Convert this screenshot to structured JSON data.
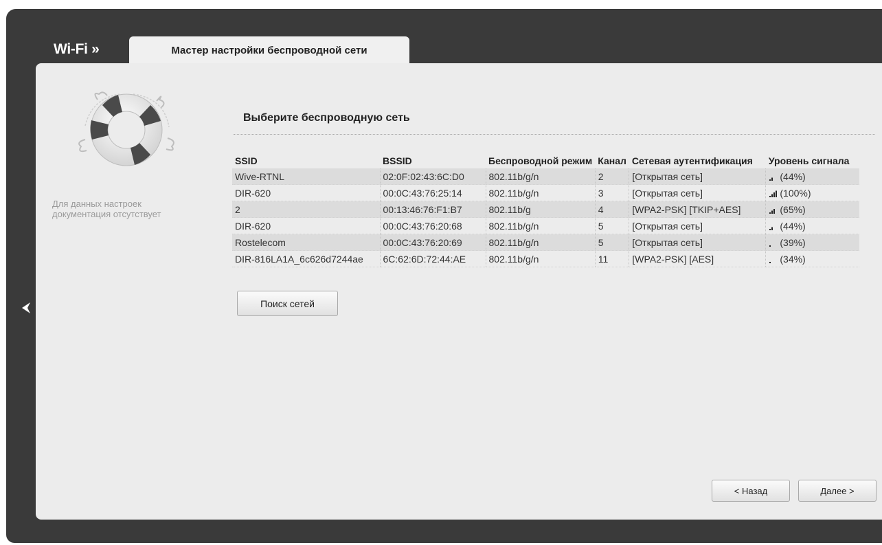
{
  "header": {
    "breadcrumb_root": "Wi-Fi »",
    "active_tab": "Мастер настройки беспроводной сети"
  },
  "sidebar": {
    "note": "Для данных настроек документация отсутствует"
  },
  "main": {
    "section_title": "Выберите беспроводную сеть",
    "table": {
      "columns": [
        "SSID",
        "BSSID",
        "Беспроводной режим",
        "Канал",
        "Сетевая аутентификация",
        "Уровень сигнала"
      ],
      "rows": [
        {
          "ssid": "Wive-RTNL",
          "bssid": "02:0F:02:43:6C:D0",
          "mode": "802.11b/g/n",
          "channel": "2",
          "auth": "[Открытая сеть]",
          "signal": "(44%)",
          "bars": 2
        },
        {
          "ssid": "DIR-620",
          "bssid": "00:0C:43:76:25:14",
          "mode": "802.11b/g/n",
          "channel": "3",
          "auth": "[Открытая сеть]",
          "signal": "(100%)",
          "bars": 4
        },
        {
          "ssid": "2",
          "bssid": "00:13:46:76:F1:B7",
          "mode": "802.11b/g",
          "channel": "4",
          "auth": "[WPA2-PSK] [TKIP+AES]",
          "signal": "(65%)",
          "bars": 3
        },
        {
          "ssid": "DIR-620",
          "bssid": "00:0C:43:76:20:68",
          "mode": "802.11b/g/n",
          "channel": "5",
          "auth": "[Открытая сеть]",
          "signal": "(44%)",
          "bars": 2
        },
        {
          "ssid": "Rostelecom",
          "bssid": "00:0C:43:76:20:69",
          "mode": "802.11b/g/n",
          "channel": "5",
          "auth": "[Открытая сеть]",
          "signal": "(39%)",
          "bars": 1
        },
        {
          "ssid": "DIR-816LA1A_6c626d7244ae",
          "bssid": "6C:62:6D:72:44:AE",
          "mode": "802.11b/g/n",
          "channel": "11",
          "auth": "[WPA2-PSK] [AES]",
          "signal": "(34%)",
          "bars": 1
        }
      ]
    },
    "scan_button": "Поиск сетей"
  },
  "footer": {
    "back_button": "< Назад",
    "next_button": "Далее >"
  },
  "colors": {
    "frame": "#3a3a3a",
    "panel": "#ececec",
    "row_odd": "#dcdcdc"
  },
  "icons": {
    "help": "lifebuoy-icon",
    "nav_back": "chevron-left-icon",
    "signal": "signal-bars-icon"
  }
}
